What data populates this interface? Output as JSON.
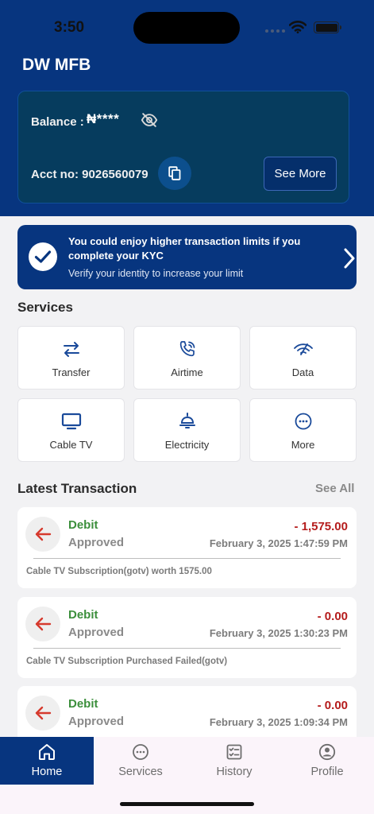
{
  "status_bar": {
    "time": "3:50"
  },
  "app": {
    "title": "DW MFB"
  },
  "balance_card": {
    "balance_label": "Balance :",
    "balance_value": "₦****",
    "account_label": "Acct no: 9026560079",
    "see_more_label": "See More"
  },
  "kyc_banner": {
    "title": "You could enjoy higher transaction limits if you complete your KYC",
    "subtitle": "Verify your identity to increase your limit"
  },
  "services": {
    "heading": "Services",
    "items": [
      {
        "label": "Transfer",
        "icon": "transfer-icon"
      },
      {
        "label": "Airtime",
        "icon": "phone-call-icon"
      },
      {
        "label": "Data",
        "icon": "signal-icon"
      },
      {
        "label": "Cable TV",
        "icon": "tv-icon"
      },
      {
        "label": "Electricity",
        "icon": "bulb-icon"
      },
      {
        "label": "More",
        "icon": "more-icon"
      }
    ]
  },
  "transactions": {
    "heading": "Latest Transaction",
    "see_all_label": "See All",
    "items": [
      {
        "type": "Debit",
        "status": "Approved",
        "amount": "- 1,575.00",
        "date": "February 3, 2025 1:47:59 PM",
        "description": "Cable TV Subscription(gotv) worth 1575.00"
      },
      {
        "type": "Debit",
        "status": "Approved",
        "amount": "- 0.00",
        "date": "February 3, 2025 1:30:23 PM",
        "description": "Cable TV Subscription Purchased Failed(gotv)"
      },
      {
        "type": "Debit",
        "status": "Approved",
        "amount": "- 0.00",
        "date": "February 3, 2025 1:09:34 PM",
        "description": ""
      }
    ]
  },
  "tab_bar": {
    "tabs": [
      {
        "label": "Home",
        "icon": "home-icon",
        "active": true
      },
      {
        "label": "Services",
        "icon": "services-icon",
        "active": false
      },
      {
        "label": "History",
        "icon": "history-icon",
        "active": false
      },
      {
        "label": "Profile",
        "icon": "profile-icon",
        "active": false
      }
    ]
  },
  "colors": {
    "brand": "#07357f",
    "debit_type": "#3c8f3c",
    "debit_amount": "#b51c1c"
  }
}
